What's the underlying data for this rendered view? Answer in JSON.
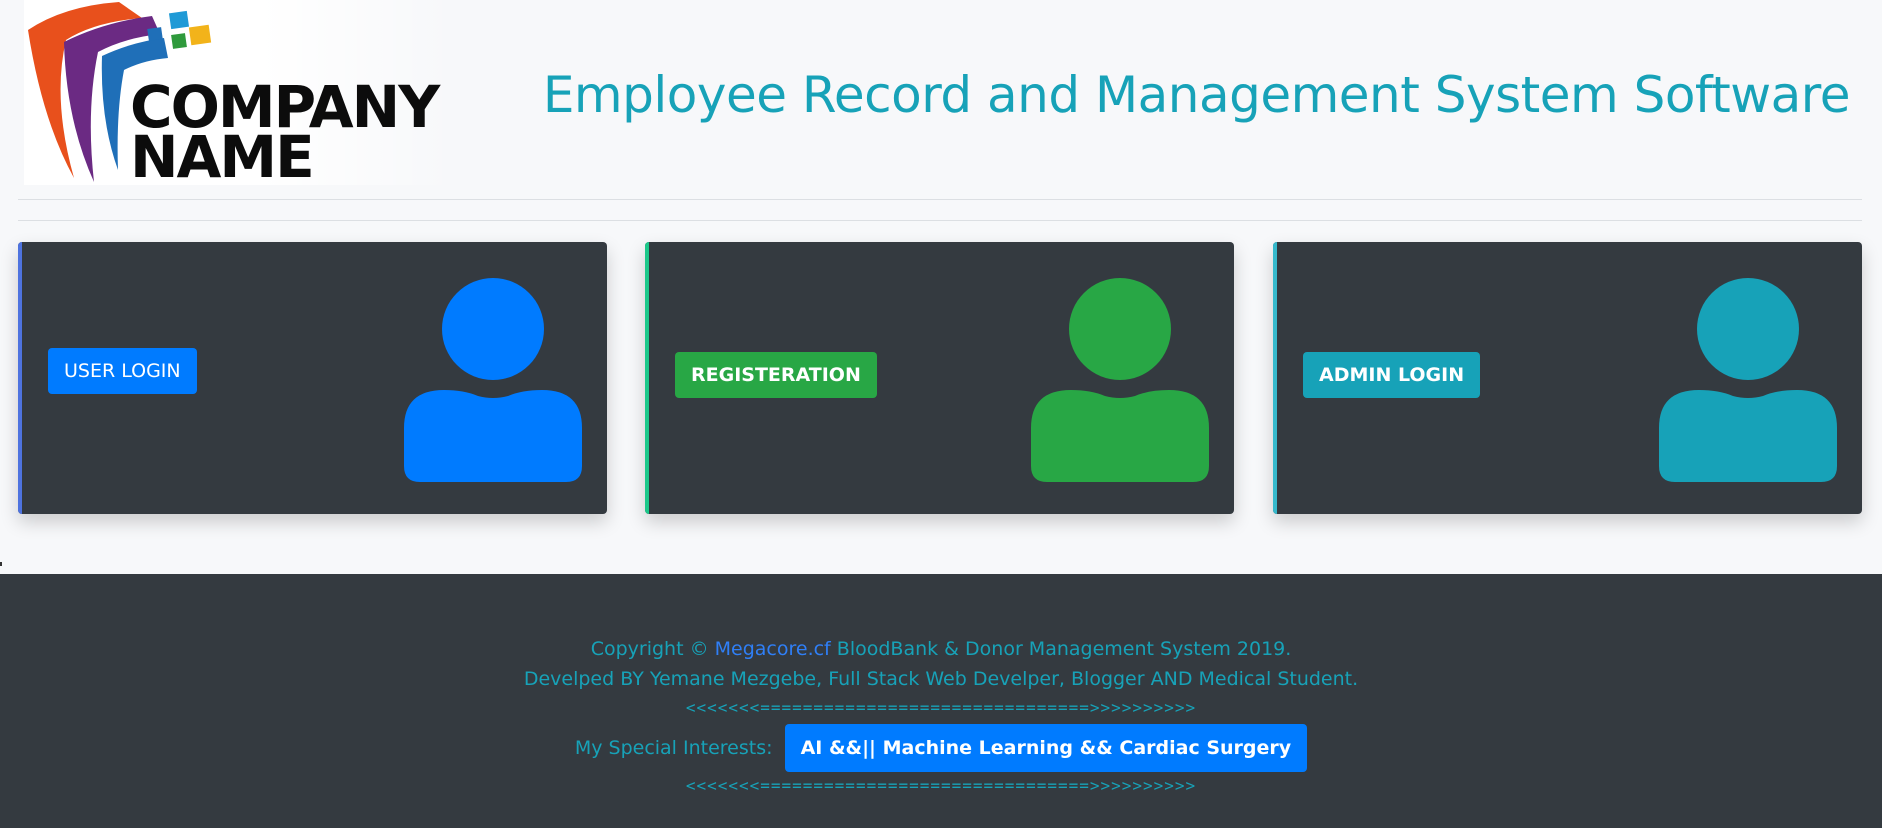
{
  "header": {
    "logo": {
      "line1": "COMPANY",
      "line2": "NAME"
    },
    "title": "Employee Record and Management System Software"
  },
  "cards": [
    {
      "button_label": "USER LOGIN",
      "color": "#007bff",
      "edge_color": "#4e73df",
      "icon": "user-icon"
    },
    {
      "button_label": "REGISTERATION",
      "color": "#28a745",
      "edge_color": "#1cc88a",
      "icon": "user-icon"
    },
    {
      "button_label": "ADMIN LOGIN",
      "color": "#17a2b8",
      "edge_color": "#36b9cc",
      "icon": "user-icon"
    }
  ],
  "footer": {
    "copyright_prefix": "Copyright ©",
    "site_link": "Megacore.cf",
    "copyright_suffix": "BloodBank & Donor Management System 2019.",
    "developer": "Develped BY Yemane Mezgebe, Full Stack Web Develper, Blogger AND Medical Student.",
    "divider_top": "<<<<<<<===============================>>>>>>>>>>",
    "interests_label": "My Special Interests:",
    "interests_badge": "AI &&|| Machine Learning && Cardiac Surgery",
    "divider_bottom": "<<<<<<<===============================>>>>>>>>>>"
  },
  "colors": {
    "accent": "#17a2b8",
    "primary": "#007bff",
    "success": "#28a745",
    "dark": "#343a40",
    "background": "#f7f8fa"
  }
}
